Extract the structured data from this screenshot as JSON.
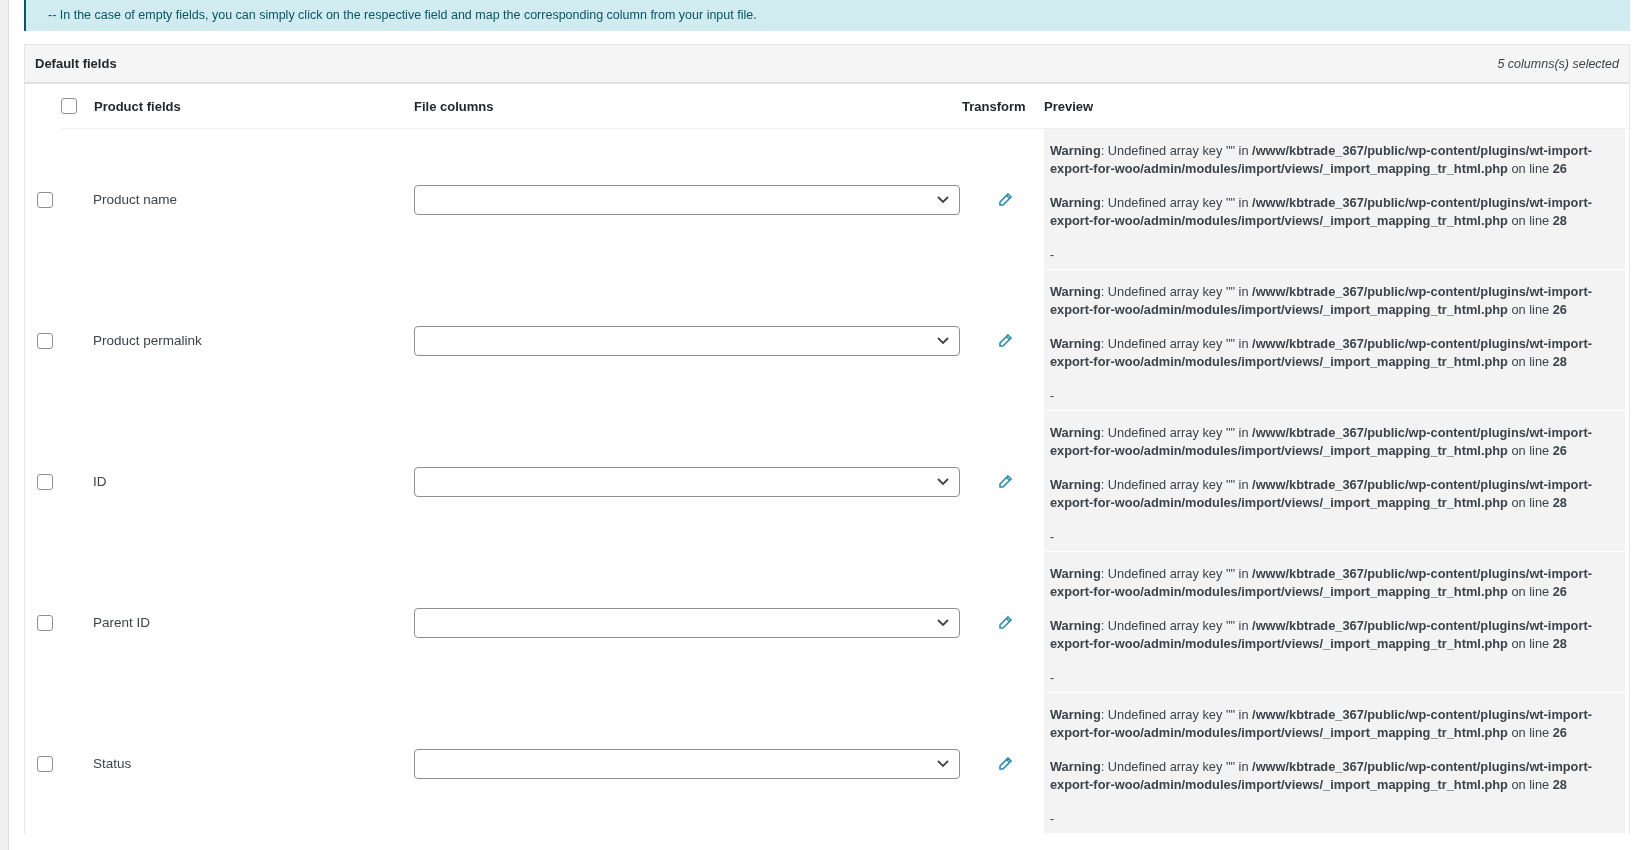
{
  "notice": {
    "lines": [
      "-- In the case of empty fields, you can simply click on the respective field and map the corresponding column from your input file."
    ]
  },
  "section": {
    "title": "Default fields",
    "selected_count": "5 columns(s) selected"
  },
  "table": {
    "header_checked": false,
    "columns": [
      "Product fields",
      "File columns",
      "Transform",
      "Preview"
    ],
    "rows": [
      {
        "checked": false,
        "field": "Product name",
        "preview": [
          "**Warning**: Undefined array key \"\" in **/www/kbtrade_367/public/wp-content/plugins/wt-import-export-for-woo/admin/modules/import/views/_import_mapping_tr_html.php** on line **26**",
          "**Warning**: Undefined array key \"\" in **/www/kbtrade_367/public/wp-content/plugins/wt-import-export-for-woo/admin/modules/import/views/_import_mapping_tr_html.php** on line **28**",
          "-"
        ]
      },
      {
        "checked": false,
        "field": "Product permalink",
        "preview": [
          "**Warning**: Undefined array key \"\" in **/www/kbtrade_367/public/wp-content/plugins/wt-import-export-for-woo/admin/modules/import/views/_import_mapping_tr_html.php** on line **26**",
          "**Warning**: Undefined array key \"\" in **/www/kbtrade_367/public/wp-content/plugins/wt-import-export-for-woo/admin/modules/import/views/_import_mapping_tr_html.php** on line **28**",
          "-"
        ]
      },
      {
        "checked": false,
        "field": "ID",
        "preview": [
          "**Warning**: Undefined array key \"\" in **/www/kbtrade_367/public/wp-content/plugins/wt-import-export-for-woo/admin/modules/import/views/_import_mapping_tr_html.php** on line **26**",
          "**Warning**: Undefined array key \"\" in **/www/kbtrade_367/public/wp-content/plugins/wt-import-export-for-woo/admin/modules/import/views/_import_mapping_tr_html.php** on line **28**",
          "-"
        ]
      },
      {
        "checked": false,
        "field": "Parent ID",
        "preview": [
          "**Warning**: Undefined array key \"\" in **/www/kbtrade_367/public/wp-content/plugins/wt-import-export-for-woo/admin/modules/import/views/_import_mapping_tr_html.php** on line **26**",
          "**Warning**: Undefined array key \"\" in **/www/kbtrade_367/public/wp-content/plugins/wt-import-export-for-woo/admin/modules/import/views/_import_mapping_tr_html.php** on line **28**",
          "-"
        ]
      },
      {
        "checked": false,
        "field": "Status",
        "preview": [
          "**Warning**: Undefined array key \"\" in **/www/kbtrade_367/public/wp-content/plugins/wt-import-export-for-woo/admin/modules/import/views/_import_mapping_tr_html.php** on line **26**",
          "**Warning**: Undefined array key \"\" in **/www/kbtrade_367/public/wp-content/plugins/wt-import-export-for-woo/admin/modules/import/views/_import_mapping_tr_html.php** on line **28**",
          "-"
        ]
      }
    ]
  }
}
